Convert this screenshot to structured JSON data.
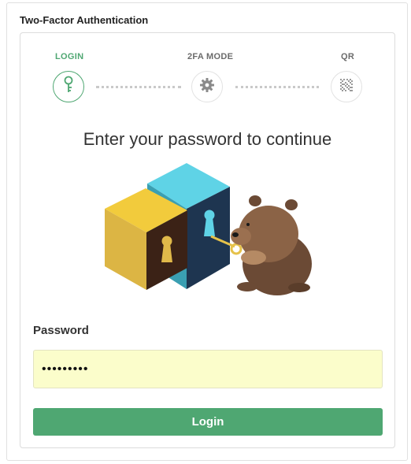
{
  "panel": {
    "title": "Two-Factor Authentication"
  },
  "steps": [
    {
      "label": "LOGIN",
      "icon": "key-icon",
      "active": true
    },
    {
      "label": "2FA MODE",
      "icon": "gear-icon",
      "active": false
    },
    {
      "label": "QR",
      "icon": "qr-code-icon",
      "active": false
    }
  ],
  "main": {
    "heading": "Enter your password to continue"
  },
  "illustration": {
    "name": "wombat-unlocking-cubes"
  },
  "form": {
    "password_label": "Password",
    "password_value": "•••••••••"
  },
  "actions": {
    "login_label": "Login"
  },
  "colors": {
    "accent": "#4fa772",
    "input_bg": "#fbfdcb",
    "inactive_text": "#6b6b6b"
  }
}
